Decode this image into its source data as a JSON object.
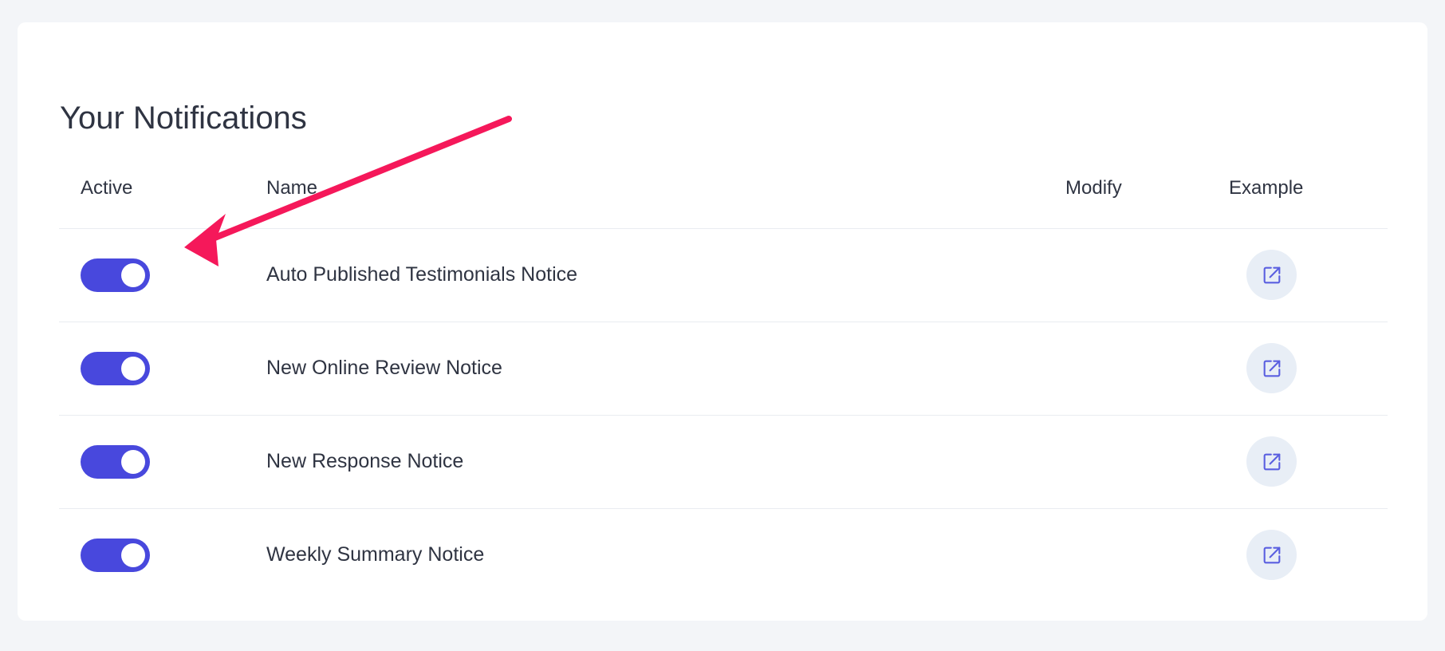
{
  "page": {
    "title": "Your Notifications"
  },
  "table": {
    "headers": {
      "active": "Active",
      "name": "Name",
      "modify": "Modify",
      "example": "Example"
    },
    "rows": [
      {
        "name": "Auto Published Testimonials Notice",
        "active": true
      },
      {
        "name": "New Online Review Notice",
        "active": true
      },
      {
        "name": "New Response Notice",
        "active": true
      },
      {
        "name": "Weekly Summary Notice",
        "active": true
      }
    ]
  },
  "icons": {
    "example": "external-link-icon"
  },
  "colors": {
    "toggle_on": "#4848dd",
    "example_icon": "#5a5fe0",
    "example_button_bg": "#e8eef6",
    "annotation_arrow": "#f5185a",
    "page_bg": "#f3f5f8",
    "card_bg": "#ffffff",
    "text": "#2f3442"
  }
}
